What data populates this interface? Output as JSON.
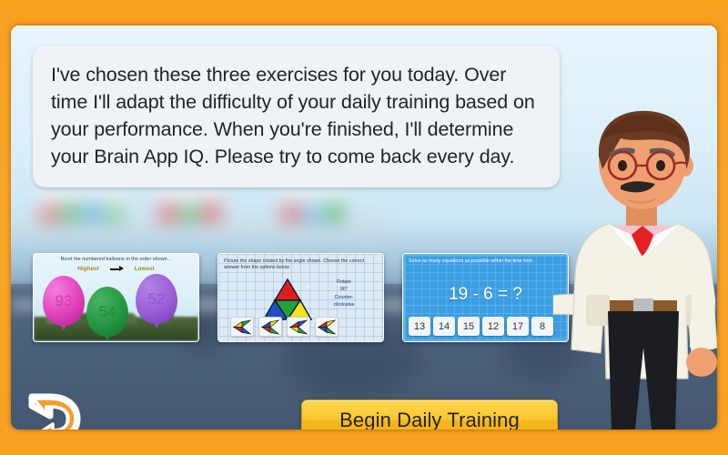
{
  "theme": {
    "frame_color": "#f9a32a",
    "panel_bg": "#9ec9e2",
    "button_color": "#fbc62f",
    "back_arrow_color": "#f79c2a"
  },
  "speech": {
    "text": "I've chosen these three exercises for you today. Over time I'll adapt the difficulty of your daily training based on your performance. When you're finished, I'll determine your Brain App IQ. Please try to come back every day."
  },
  "exercises": {
    "balloons": {
      "title": "Burst the numbered balloons in the order shown...",
      "order_from": "Highest",
      "order_to": "Lowest",
      "balloons": [
        {
          "value": "93",
          "color": "#e040b8"
        },
        {
          "value": "54",
          "color": "#239642"
        },
        {
          "value": "52",
          "color": "#9b5cd6"
        }
      ]
    },
    "rotation": {
      "title": "Picture the shape rotated by the angle shown. Choose the correct answer from the options below.",
      "instruction_line1": "Rotate",
      "instruction_line2": "90°",
      "instruction_line3": "Counter-",
      "instruction_line4": "clockwise",
      "shape_colors": {
        "top": "#e11c1c",
        "center": "#22a139",
        "left": "#1e4fc4",
        "right": "#f2e514"
      },
      "option_count": 4
    },
    "math": {
      "title": "Solve as many equations as possible within the time limit",
      "equation": "19 - 6 = ?",
      "answers": [
        "13",
        "14",
        "15",
        "12",
        "17",
        "8"
      ]
    }
  },
  "buttons": {
    "begin": "Begin Daily Training",
    "back_icon": "back-arrow-icon"
  },
  "character": {
    "name": "doctor-character",
    "skin": "#f0a070",
    "hair": "#6b3a22",
    "coat": "#f4f2e6",
    "shirt": "#f9c2d0",
    "tie": "#e61f22",
    "trousers": "#1b1d22",
    "glasses": "#9b2b26"
  }
}
